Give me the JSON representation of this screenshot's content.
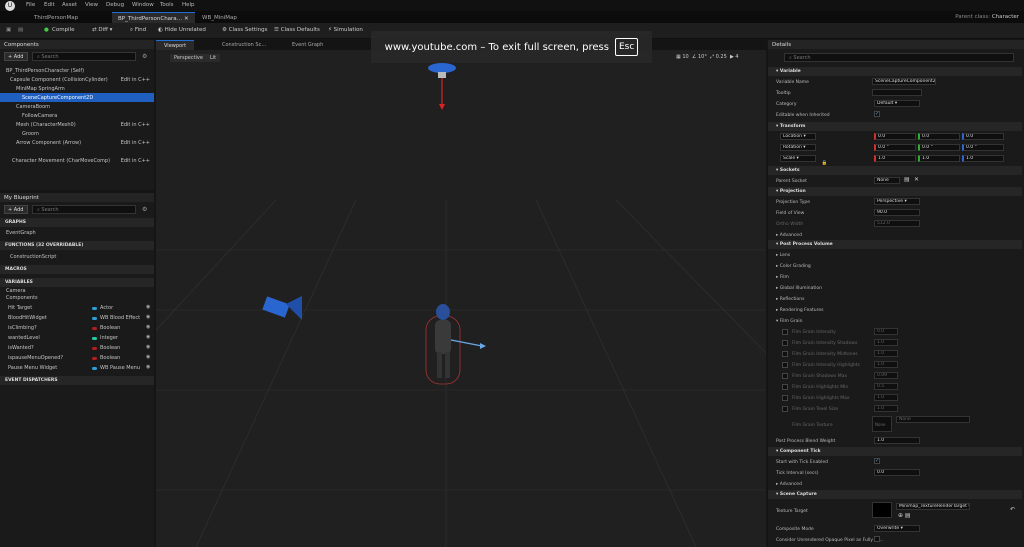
{
  "menu": [
    "File",
    "Edit",
    "Asset",
    "View",
    "Debug",
    "Window",
    "Tools",
    "Help"
  ],
  "tabs": [
    "ThirdPersonMap",
    "BP_ThirdPersonChara…",
    "WB_MiniMap"
  ],
  "parent_class_label": "Parent class:",
  "parent_class": "Character",
  "toolbar": {
    "compile": "Compile",
    "diff": "Diff",
    "find": "Find",
    "hide": "Hide Unrelated",
    "class_settings": "Class Settings",
    "class_defaults": "Class Defaults",
    "simulation": "Simulation"
  },
  "overlay": {
    "text": "www.youtube.com – To exit full screen, press",
    "key": "Esc"
  },
  "components": {
    "title": "Components",
    "add": "+ Add",
    "search": "Search",
    "items": [
      {
        "label": "BP_ThirdPersonCharacter (Self)",
        "link": ""
      },
      {
        "label": "Capsule Component (CollisionCylinder)",
        "link": "Edit in C++"
      },
      {
        "label": "MiniMap SpringArm",
        "link": ""
      },
      {
        "label": "SceneCaptureComponent2D",
        "link": ""
      },
      {
        "label": "CameraBoom",
        "link": ""
      },
      {
        "label": "FollowCamera",
        "link": ""
      },
      {
        "label": "Mesh (CharacterMesh0)",
        "link": "Edit in C++"
      },
      {
        "label": "Groom",
        "link": ""
      },
      {
        "label": "Arrow Component (Arrow)",
        "link": "Edit in C++"
      },
      {
        "label": "Character Movement (CharMoveComp)",
        "link": "Edit in C++"
      }
    ]
  },
  "blueprint": {
    "title": "My Blueprint",
    "add": "+ Add",
    "search": "Search",
    "graphs": "GRAPHS",
    "event_graph": "EventGraph",
    "functions": "FUNCTIONS (32 OVERRIDABLE)",
    "construction": "ConstructionScript",
    "macros": "MACROS",
    "variables": "VARIABLES",
    "camera": "Camera",
    "components": "Components",
    "vars": [
      {
        "name": "Hit Target",
        "type": "Actor",
        "color": "#2a9fd6"
      },
      {
        "name": "BloodHitWidget",
        "type": "WB Blood Effect",
        "color": "#2a9fd6"
      },
      {
        "name": "isClimbing?",
        "type": "Boolean",
        "color": "#b01e1e"
      },
      {
        "name": "wantedLevel",
        "type": "Integer",
        "color": "#1fc9a3"
      },
      {
        "name": "isWanted?",
        "type": "Boolean",
        "color": "#b01e1e"
      },
      {
        "name": "ispauseMenuOpened?",
        "type": "Boolean",
        "color": "#b01e1e"
      },
      {
        "name": "Pause Menu Widget",
        "type": "WB Pause Menu",
        "color": "#2a9fd6"
      }
    ],
    "dispatchers": "EVENT DISPATCHERS"
  },
  "center_tabs": [
    "Viewport",
    "Construction Sc…",
    "Event Graph"
  ],
  "viewport": {
    "perspective": "Perspective",
    "lit": "Lit",
    "stats": [
      "10",
      "10°",
      "0.25",
      "4"
    ]
  },
  "details": {
    "title": "Details",
    "search": "Search",
    "variable": "Variable",
    "var_name_label": "Variable Name",
    "var_name": "SceneCaptureComponent2D",
    "tooltip": "Tooltip",
    "category_label": "Category",
    "category": "Default",
    "editable": "Editable when Inherited",
    "transform": "Transform",
    "location": "Location",
    "rotation": "Rotation",
    "scale": "Scale",
    "loc": [
      "0.0",
      "0.0",
      "0.0"
    ],
    "rot": [
      "0.0 °",
      "0.0 °",
      "0.0 °"
    ],
    "scl": [
      "1.0",
      "1.0",
      "1.0"
    ],
    "sockets": "Sockets",
    "parent_socket": "Parent Socket",
    "socket_val": "None",
    "projection": "Projection",
    "proj_type_label": "Projection Type",
    "proj_type": "Perspective",
    "fov_label": "Field of View",
    "fov": "90.0",
    "ortho_label": "Ortho Width",
    "ortho": "512.0",
    "advanced": "Advanced",
    "ppv": "Post Process Volume",
    "pp_items": [
      "Lens",
      "Color Grading",
      "Film",
      "Global Illumination",
      "Reflections",
      "Rendering Features"
    ],
    "film_grain": "Film Grain",
    "fg_items": [
      {
        "l": "Film Grain Intensity",
        "v": "0.0"
      },
      {
        "l": "Film Grain Intensity Shadows",
        "v": "1.0"
      },
      {
        "l": "Film Grain Intensity Midtones",
        "v": "1.0"
      },
      {
        "l": "Film Grain Intensity Highlights",
        "v": "1.0"
      },
      {
        "l": "Film Grain Shadows Max",
        "v": "0.09"
      },
      {
        "l": "Film Grain Highlights Min",
        "v": "0.5"
      },
      {
        "l": "Film Grain Highlights Max",
        "v": "1.0"
      },
      {
        "l": "Film Grain Texel Size",
        "v": "1.0"
      }
    ],
    "fg_texture": "Film Grain Texture",
    "none": "None",
    "blend_label": "Post Process Blend Weight",
    "blend": "1.0",
    "comp_tick": "Component Tick",
    "tick_enabled": "Start with Tick Enabled",
    "tick_interval": "Tick Interval (secs)",
    "tick_val": "0.0",
    "advanced2": "Advanced",
    "scene_capture": "Scene Capture",
    "texture_target": "Texture Target",
    "tex_val": "Minimap_TextureRenderTarget",
    "comp_mode": "Composite Mode",
    "comp_val": "Overwrite",
    "consider": "Consider Unrendered Opaque Pixel as Fully Tr…"
  }
}
